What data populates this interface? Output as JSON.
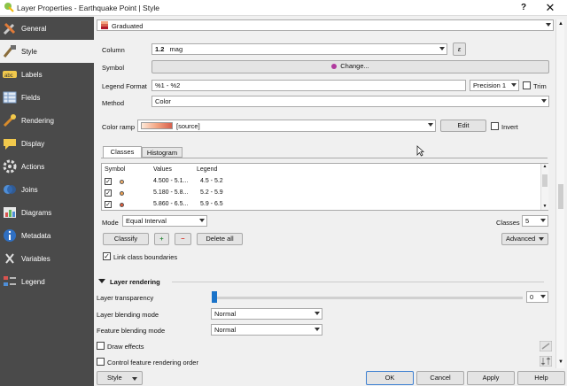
{
  "window": {
    "title": "Layer Properties - Earthquake Point | Style",
    "help": "?",
    "close": "✕"
  },
  "sidebar": {
    "items": [
      {
        "label": "General",
        "icon": "general-tools-icon"
      },
      {
        "label": "Style",
        "icon": "style-brush-icon"
      },
      {
        "label": "Labels",
        "icon": "labels-abc-icon"
      },
      {
        "label": "Fields",
        "icon": "fields-table-icon"
      },
      {
        "label": "Rendering",
        "icon": "rendering-brush-icon"
      },
      {
        "label": "Display",
        "icon": "display-bubble-icon"
      },
      {
        "label": "Actions",
        "icon": "actions-gear-icon"
      },
      {
        "label": "Joins",
        "icon": "joins-icon"
      },
      {
        "label": "Diagrams",
        "icon": "diagrams-icon"
      },
      {
        "label": "Metadata",
        "icon": "metadata-info-icon"
      },
      {
        "label": "Variables",
        "icon": "variables-icon"
      },
      {
        "label": "Legend",
        "icon": "legend-icon"
      }
    ]
  },
  "renderer": {
    "value": "Graduated"
  },
  "column": {
    "label": "Column",
    "prefix": "1.2",
    "value": "mag"
  },
  "symbol": {
    "label": "Symbol",
    "button": "Change..."
  },
  "legend_format": {
    "label": "Legend Format",
    "value": "%1 - %2",
    "precision_label": "Precision 1",
    "trim_label": "Trim"
  },
  "method": {
    "label": "Method",
    "value": "Color"
  },
  "color_ramp": {
    "label": "Color ramp",
    "value": "[source]",
    "edit": "Edit",
    "invert": "Invert",
    "colors": [
      "#fde8d8",
      "#f4a582",
      "#d6604d"
    ]
  },
  "tabs": {
    "classes": "Classes",
    "histogram": "Histogram"
  },
  "table": {
    "headers": [
      "Symbol",
      "Values",
      "Legend"
    ],
    "rows": [
      {
        "checked": true,
        "color": "#f6b26b",
        "values": "4.500 - 5.1...",
        "legend": "4.5 - 5.2"
      },
      {
        "checked": true,
        "color": "#f0a050",
        "values": "5.180 - 5.8...",
        "legend": "5.2 - 5.9"
      },
      {
        "checked": true,
        "color": "#e25c3a",
        "values": "5.860 - 6.5...",
        "legend": "5.9 - 6.5"
      }
    ]
  },
  "mode": {
    "label": "Mode",
    "value": "Equal Interval",
    "classes_label": "Classes",
    "classes_value": "5"
  },
  "actions": {
    "classify": "Classify",
    "add": "+",
    "remove": "−",
    "delete_all": "Delete all",
    "advanced": "Advanced"
  },
  "link_boundaries": {
    "label": "Link class boundaries",
    "checked": true
  },
  "layer_rendering": {
    "title": "Layer rendering",
    "transparency_label": "Layer transparency",
    "transparency_value": "0",
    "transparency_level": 0,
    "blending_label": "Layer blending mode",
    "blending_value": "Normal",
    "feature_blending_label": "Feature blending mode",
    "feature_blending_value": "Normal",
    "draw_effects": "Draw effects",
    "control_order": "Control feature rendering order"
  },
  "footer": {
    "style": "Style",
    "ok": "OK",
    "cancel": "Cancel",
    "apply": "Apply",
    "help": "Help"
  }
}
